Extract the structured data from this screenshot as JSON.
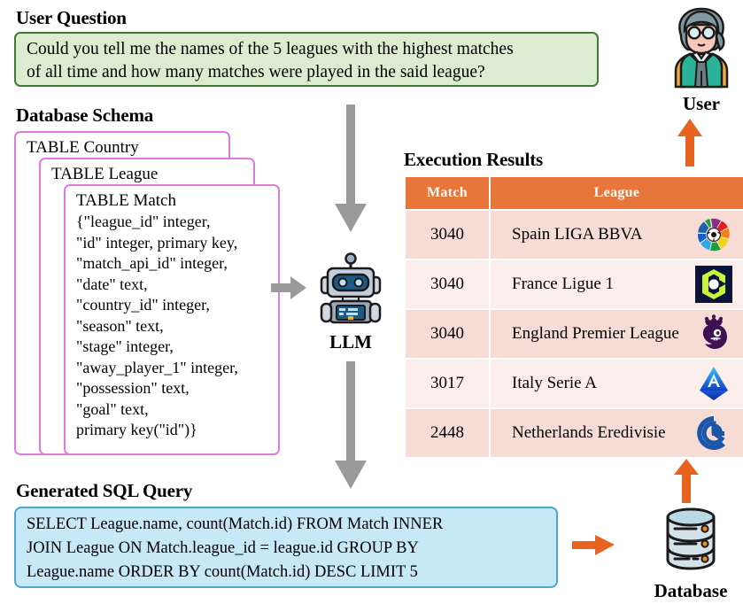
{
  "user_question": {
    "title": "User Question",
    "lines": [
      "Could you tell me the names of the 5 leagues with the highest matches",
      "of all time and how many matches were played in the said league?"
    ],
    "box_fill": "#dcecd0",
    "box_border": "#3f7a35"
  },
  "schema": {
    "title": "Database Schema",
    "border_color": "#e07ae0",
    "cards": [
      {
        "label": "TABLE Country"
      },
      {
        "label": "TABLE League"
      },
      {
        "label": "TABLE Match",
        "fields": [
          "{\"league_id\" integer,",
          " \"id\" integer, primary key,",
          " \"match_api_id\" integer,",
          " \"date\" text,",
          " \"country_id\" integer,",
          " \"season\" text,",
          " \"stage\" integer,",
          " \"away_player_1\" integer,",
          " \"possession\" text,",
          " \"goal\" text,",
          " primary key(\"id\")}"
        ]
      }
    ]
  },
  "llm": {
    "label": "LLM",
    "icon": "robot-icon"
  },
  "user": {
    "label": "User",
    "icon": "user-avatar-icon"
  },
  "database": {
    "label": "Database",
    "icon": "database-cylinder-icon"
  },
  "results": {
    "title": "Execution Results",
    "header_color": "#e8763a",
    "row_colors": [
      "#f6dcd5",
      "#fbeeea"
    ],
    "columns": [
      "Match",
      "League"
    ],
    "rows": [
      {
        "match": "3040",
        "league": "Spain LIGA BBVA",
        "logo": "laliga-logo-icon"
      },
      {
        "match": "3040",
        "league": "France Ligue 1",
        "logo": "ligue1-logo-icon"
      },
      {
        "match": "3040",
        "league": "England Premier League",
        "logo": "premier-league-logo-icon"
      },
      {
        "match": "3017",
        "league": "Italy Serie A",
        "logo": "serie-a-logo-icon"
      },
      {
        "match": "2448",
        "league": "Netherlands Eredivisie",
        "logo": "eredivisie-logo-icon"
      }
    ]
  },
  "sql": {
    "title": "Generated SQL Query",
    "lines": [
      "SELECT League.name, count(Match.id) FROM Match INNER",
      "JOIN League ON Match.league_id = league.id GROUP BY",
      "League.name ORDER BY count(Match.id) DESC LIMIT 5"
    ],
    "box_fill": "#c6e8f7",
    "box_border": "#4ba8cd"
  },
  "arrows": {
    "gray_color": "#9a9a9a",
    "orange_color": "#e8631f"
  }
}
